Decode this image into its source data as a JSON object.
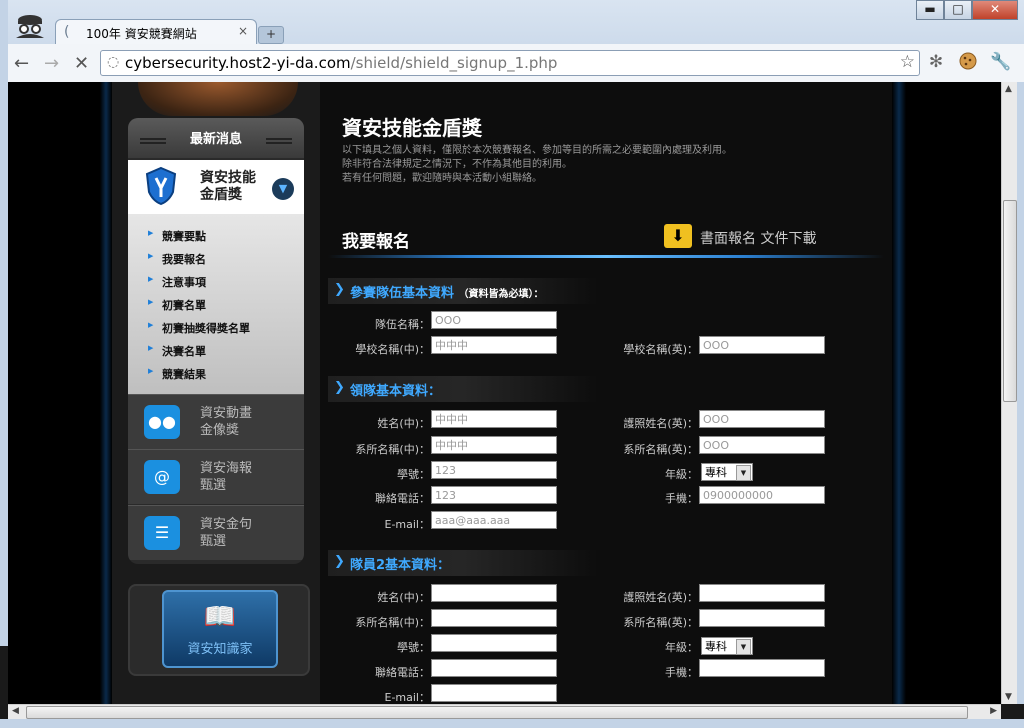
{
  "browser": {
    "tab_title": "100年 資安競賽網站",
    "tab_close": "×",
    "new_tab": "+",
    "url_host": "cybersecurity.host2-yi-da.com",
    "url_path": "/shield/shield_signup_1.php",
    "back": "←",
    "forward": "→",
    "stop": "✕",
    "star": "☆",
    "ext_icons": [
      "gear-icon",
      "cookie-icon",
      "wrench-icon"
    ],
    "win_min": "▬",
    "win_max": "□",
    "win_close": "✕"
  },
  "sidebar": {
    "news": "最新消息",
    "active": "資安技能\n金盾獎",
    "sub_items": [
      "競賽要點",
      "我要報名",
      "注意事項",
      "初賽名單",
      "初賽抽獎得獎名單",
      "決賽名單",
      "競賽結果"
    ],
    "others": [
      {
        "label": "資安動畫\n金像獎",
        "icon": "video-camera-icon"
      },
      {
        "label": "資安海報\n甄選",
        "icon": "email-at-icon"
      },
      {
        "label": "資安金句\n甄選",
        "icon": "speech-bubble-icon"
      }
    ],
    "knowledge": "資安知識家"
  },
  "main": {
    "title": "資安技能金盾獎",
    "intro": "以下填具之個人資料，僅限於本次競賽報名、參加等目的所需之必要範圍內處理及利用。\n除非符合法律規定之情況下，不作為其他目的利用。\n若有任何問題，歡迎隨時與本活動小組聯絡。",
    "signup": "我要報名",
    "download": "書面報名  文件下載",
    "sec1": {
      "title": "參賽隊伍基本資料",
      "note": "（資料皆為必填）：",
      "team_label": "隊伍名稱：",
      "team_value": "OOO",
      "school_zh_label": "學校名稱(中)：",
      "school_zh_value": "中中中",
      "school_en_label": "學校名稱(英)：",
      "school_en_value": "OOO"
    },
    "sec2": {
      "title": "領隊基本資料：",
      "name_zh_label": "姓名(中)：",
      "name_zh_value": "中中中",
      "passport_label": "護照姓名(英)：",
      "passport_value": "OOO",
      "dept_zh_label": "系所名稱(中)：",
      "dept_zh_value": "中中中",
      "dept_en_label": "系所名稱(英)：",
      "dept_en_value": "OOO",
      "id_label": "學號：",
      "id_value": "123",
      "grade_label": "年級：",
      "grade_value": "專科",
      "phone_label": "聯絡電話：",
      "phone_value": "123",
      "mobile_label": "手機：",
      "mobile_value": "0900000000",
      "email_label": "E-mail：",
      "email_value": "aaa@aaa.aaa"
    },
    "sec3": {
      "title": "隊員2基本資料：",
      "name_zh_label": "姓名(中)：",
      "passport_label": "護照姓名(英)：",
      "dept_zh_label": "系所名稱(中)：",
      "dept_en_label": "系所名稱(英)：",
      "id_label": "學號：",
      "grade_label": "年級：",
      "grade_value": "專科",
      "phone_label": "聯絡電話：",
      "mobile_label": "手機：",
      "email_label": "E-mail："
    }
  }
}
